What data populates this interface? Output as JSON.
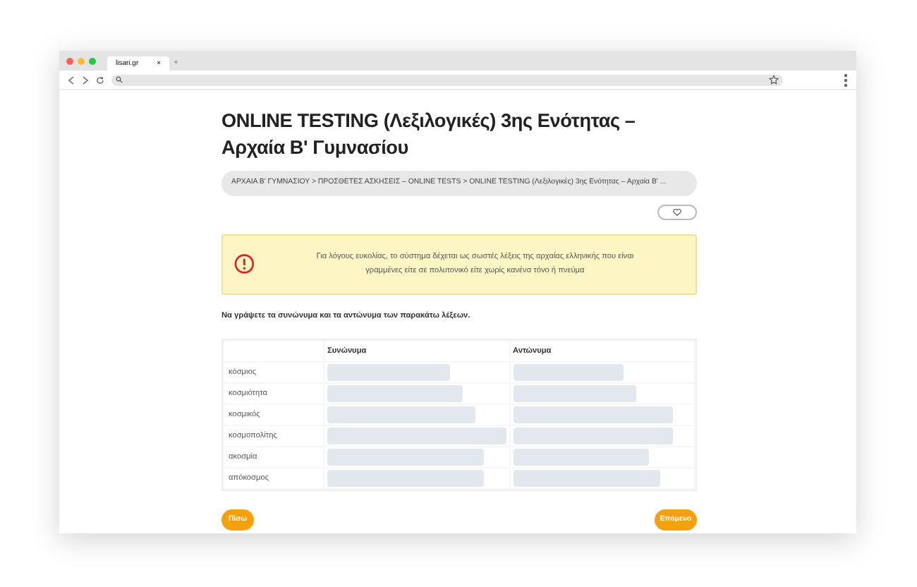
{
  "browser": {
    "tab_title": "lisari.gr",
    "tab_close": "×",
    "new_tab": "+"
  },
  "page": {
    "title": "ONLINE TESTING (Λεξιλογικές) 3ης Ενότητας – Αρχαία Β' Γυμνασίου",
    "breadcrumb": "ΑΡΧΑΙΑ Β' ΓΥΜΝΑΣΙΟΥ > ΠΡΟΣΘΕΤΕΣ ΑΣΚΗΣΕΙΣ – ONLINE TESTS > ONLINE TESTING (Λεξιλογικές) 3ης Ενότητας – Αρχαία Β' ...",
    "notice": "Για λόγους ευκολίας, το σύστημα δέχεται ως σωστές λέξεις της αρχαίας ελληνικής που είναι γραμμένες είτε σε πολυτονικό είτε χωρίς κανένα τόνο ή πνεύμα",
    "instruction": "Να γράψετε τα συνώνυμα και τα αντώνυμα των παρακάτω λέξεων.",
    "table": {
      "columns": [
        "Συνώνυμα",
        "Αντώνυμα"
      ],
      "rows": [
        {
          "word": "κόσμιος"
        },
        {
          "word": "κοσμιότητα"
        },
        {
          "word": "κοσμικός"
        },
        {
          "word": "κοσμοπολίτης"
        },
        {
          "word": "ακοσμία"
        },
        {
          "word": "απόκοσμος"
        }
      ]
    },
    "buttons": {
      "back": "Πίσω",
      "next": "Επόμενο"
    }
  }
}
